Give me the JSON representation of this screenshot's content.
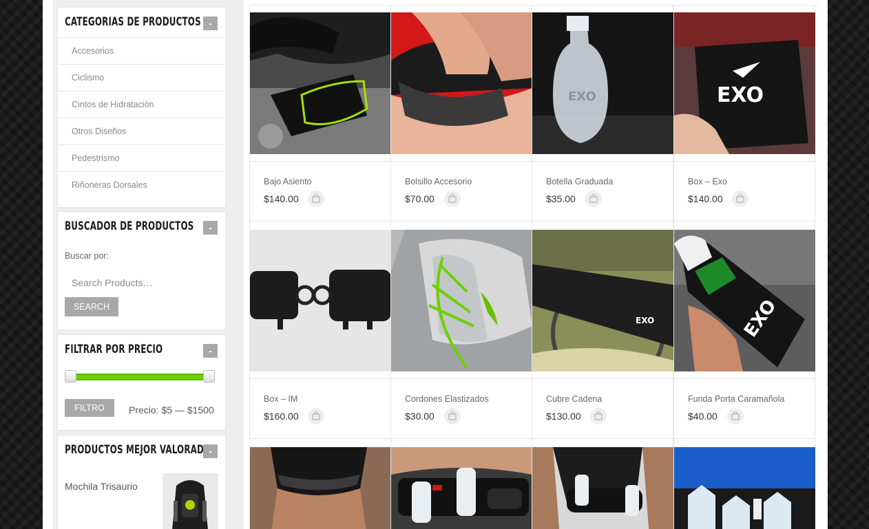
{
  "sidebar": {
    "categories": {
      "title": "Categorias de productos",
      "toggle": "-",
      "items": [
        {
          "label": "Accesorios"
        },
        {
          "label": "Ciclismo"
        },
        {
          "label": "Cintos de Hidratación"
        },
        {
          "label": "Otros Diseños"
        },
        {
          "label": "Pedestrismo"
        },
        {
          "label": "Riñoneras Dorsales"
        }
      ]
    },
    "search": {
      "title": "Buscador de productos",
      "toggle": "-",
      "label": "Buscar por:",
      "placeholder": "Search Products…",
      "button": "Search"
    },
    "price_filter": {
      "title": "Filtrar por precio",
      "toggle": "-",
      "button": "Filtro",
      "price_text": "Precio: $5 — $1500",
      "min": 5,
      "max": 1500,
      "selected_min": 5,
      "selected_max": 1500,
      "accent_color": "#6fd000"
    },
    "top_rated": {
      "title": "Productos mejor valorados",
      "toggle": "-",
      "item_name": "Mochila Trisaurio"
    }
  },
  "products": [
    {
      "name": "Bajo Asiento",
      "price": "$140.00",
      "image_icon": "bike-seat-bag-image"
    },
    {
      "name": "Bolsillo Accesorio",
      "price": "$70.00",
      "image_icon": "belt-pocket-image"
    },
    {
      "name": "Botella Graduada",
      "price": "$35.00",
      "image_icon": "soft-flask-image"
    },
    {
      "name": "Box – Exo",
      "price": "$140.00",
      "image_icon": "exo-box-image"
    },
    {
      "name": "Box – IM",
      "price": "$160.00",
      "image_icon": "im-box-image"
    },
    {
      "name": "Cordones Elastizados",
      "price": "$30.00",
      "image_icon": "elastic-laces-image"
    },
    {
      "name": "Cubre Cadena",
      "price": "$130.00",
      "image_icon": "chain-cover-image"
    },
    {
      "name": "Funda Porta Caramañola",
      "price": "$40.00",
      "image_icon": "bottle-sleeve-image"
    },
    {
      "name": "",
      "price": "",
      "image_icon": "hydration-belt-image"
    },
    {
      "name": "",
      "price": "",
      "image_icon": "hydration-belt-bottles-image"
    },
    {
      "name": "",
      "price": "",
      "image_icon": "waist-belt-image"
    },
    {
      "name": "",
      "price": "",
      "image_icon": "flasks-image"
    }
  ],
  "brand_logo_text": "EXO"
}
